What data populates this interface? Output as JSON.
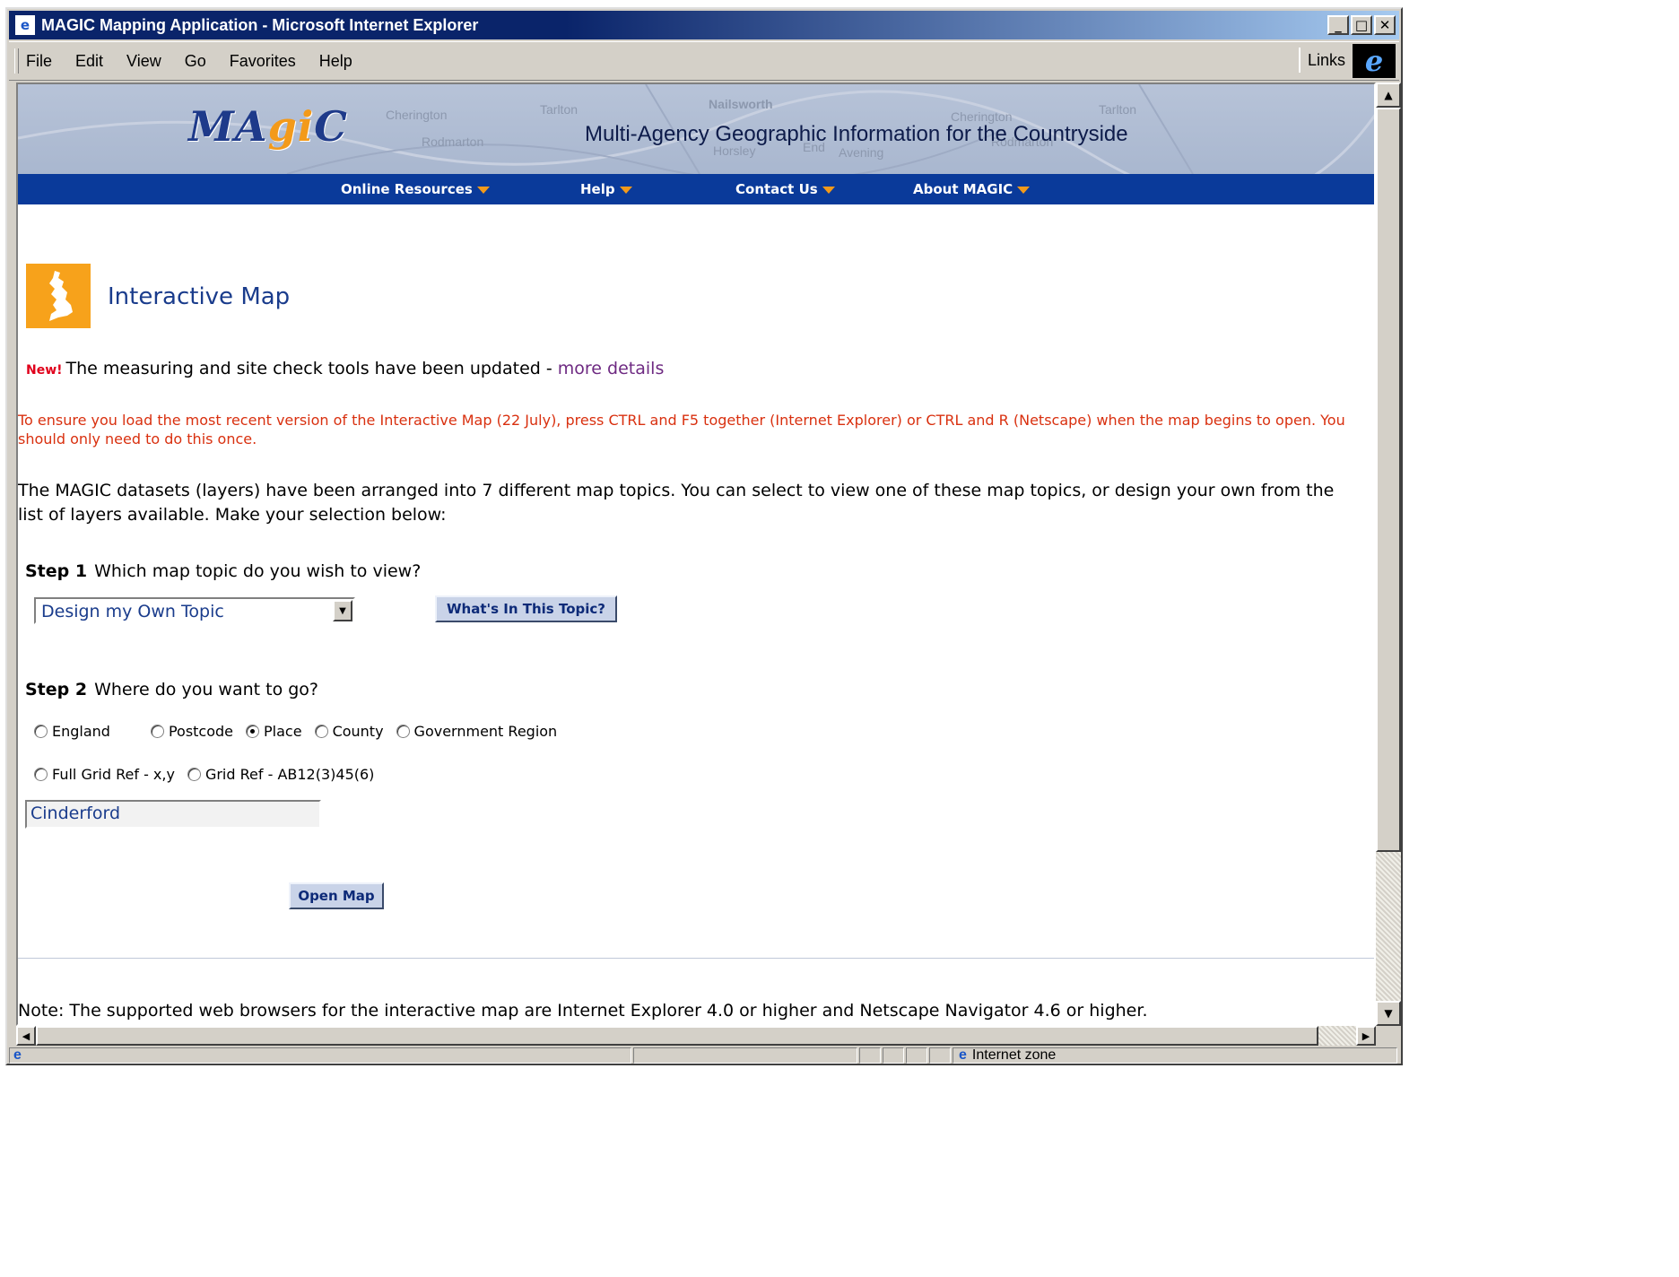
{
  "window": {
    "title": "MAGIC Mapping Application - Microsoft Internet Explorer"
  },
  "menu": {
    "items": [
      "File",
      "Edit",
      "View",
      "Go",
      "Favorites",
      "Help"
    ],
    "links_label": "Links"
  },
  "banner": {
    "logo": "MAgiC",
    "tagline": "Multi-Agency Geographic Information for the Countryside",
    "map_labels": [
      "Nailsworth",
      "Cherington",
      "Tarlton",
      "Rodmarton",
      "Horsley",
      "End",
      "Avening",
      "Cherington",
      "Tarlton",
      "Rodmarton"
    ]
  },
  "nav": {
    "items": [
      "Online Resources",
      "Help",
      "Contact Us",
      "About MAGIC"
    ]
  },
  "page": {
    "title": "Interactive Map",
    "new_badge": "New!",
    "new_text": "The measuring and site check tools have been updated - ",
    "new_link": "more details",
    "warning": "To ensure you load the most recent version of the Interactive Map (22 July), press CTRL and F5 together (Internet Explorer) or CTRL and R (Netscape) when the map begins to open. You should only need to do this once.",
    "intro": "The MAGIC datasets (layers) have been arranged into 7 different map topics. You can select to view one of these map topics, or design your own from the list of layers available. Make your selection below:",
    "step1_label": "Step 1",
    "step1_text": "Which map topic do you wish to view?",
    "topic_selected": "Design my Own Topic",
    "topic_button": "What's In This Topic?",
    "step2_label": "Step 2",
    "step2_text": "Where do you want to go?",
    "radio_row1": [
      "England",
      "Postcode",
      "Place",
      "County",
      "Government Region"
    ],
    "radio_row2": [
      "Full Grid Ref - x,y",
      "Grid Ref - AB12(3)45(6)"
    ],
    "radio_selected": "Place",
    "place_value": "Cinderford",
    "open_button": "Open Map",
    "note": "Note: The supported web browsers for the interactive map are Internet Explorer 4.0 or higher and Netscape Navigator 4.6 or higher."
  },
  "status": {
    "zone": "Internet zone"
  },
  "colors": {
    "nav_bg": "#0a3a9a",
    "accent_orange": "#f39a1a",
    "title_blue": "#1a3c8c",
    "warning_red": "#d9300f"
  }
}
